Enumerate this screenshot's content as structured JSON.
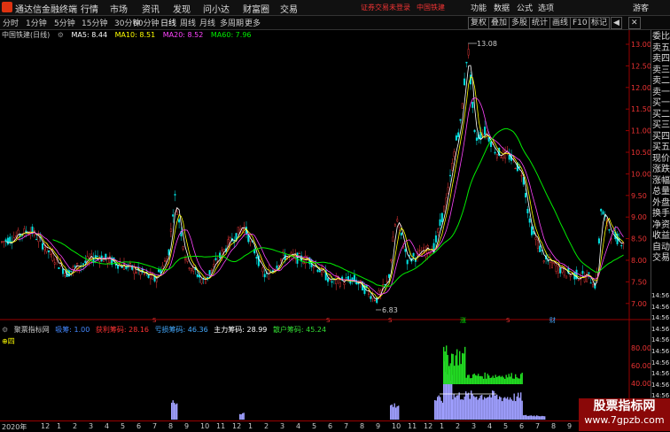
{
  "app": {
    "title": "通达信金融终端"
  },
  "menu": [
    "行情",
    "市场",
    "资讯",
    "发现",
    "问小达",
    "财富圈",
    "交易"
  ],
  "status": {
    "login": "证券交易未登录",
    "stock": "中国铁建"
  },
  "right_menu": [
    "功能",
    "数据",
    "公式",
    "选项"
  ],
  "guest": "游客",
  "periods": [
    "分时",
    "1分钟",
    "5分钟",
    "15分钟",
    "30分钟",
    "60分钟",
    "日线",
    "周线",
    "月线",
    "多周期",
    "更多"
  ],
  "active_period": "日线",
  "right_buttons": [
    "复权",
    "叠加",
    "多股",
    "统计",
    "画线",
    "F10",
    "标记"
  ],
  "window_buttons": {
    "back": "◀",
    "close": "✕"
  },
  "ma_header": {
    "stock": "中国铁建(日线)",
    "ma5": "MA5: 8.44",
    "ma10": "MA10: 8.51",
    "ma20": "MA20: 8.52",
    "ma60": "MA60: 7.96",
    "colors": {
      "ma5": "#ffffff",
      "ma10": "#ffff00",
      "ma20": "#ff44ff",
      "ma60": "#00e000"
    }
  },
  "price_axis": [
    "13.00",
    "12.50",
    "12.00",
    "11.50",
    "11.00",
    "10.50",
    "10.00",
    "9.50",
    "9.00",
    "8.50",
    "8.00",
    "7.50",
    "7.00"
  ],
  "annotations": {
    "high": "13.08",
    "low": "6.83"
  },
  "markers": [
    "S",
    "S",
    "S",
    "涨",
    "S",
    "财"
  ],
  "side_panel": [
    "委比",
    "卖五",
    "卖四",
    "卖三",
    "卖二",
    "卖一",
    "买一",
    "买二",
    "买三",
    "买四",
    "买五",
    "现价",
    "涨跌",
    "涨幅",
    "总量",
    "外盘",
    "换手",
    "净资",
    "收益",
    "自动",
    "交易"
  ],
  "side_times": [
    "14:56",
    "14:56",
    "14:56",
    "14:56",
    "14:56",
    "14:56",
    "14:56",
    "14:56",
    "14:56",
    "14:56",
    "14:56"
  ],
  "indicator": {
    "name": "聚票指标网",
    "items": [
      {
        "label": "吸筹: 1.00",
        "color": "#4488ff"
      },
      {
        "label": "获利筹码: 28.16",
        "color": "#ff3333"
      },
      {
        "label": "亏损筹码: 46.36",
        "color": "#44aaff"
      },
      {
        "label": "主力筹码: 28.99",
        "color": "#ffffff"
      },
      {
        "label": "散户筹码: 45.24",
        "color": "#33dd33"
      }
    ],
    "tag": "⊕四",
    "axis": [
      "80.00",
      "60.00",
      "40.00",
      "20.00"
    ]
  },
  "x_axis": [
    "2020年",
    "12",
    "1",
    "2",
    "3",
    "4",
    "5",
    "6",
    "7",
    "8",
    "9",
    "10",
    "11",
    "12",
    "1",
    "2",
    "3",
    "4",
    "5",
    "6",
    "7",
    "8",
    "9",
    "10",
    "11",
    "12",
    "1",
    "2",
    "3",
    "4",
    "5",
    "6",
    "7",
    "8",
    "9",
    "10",
    "11",
    "12",
    "1"
  ],
  "watermark": {
    "line1": "股票指标网",
    "line2": "www.7gpzb.com"
  }
}
